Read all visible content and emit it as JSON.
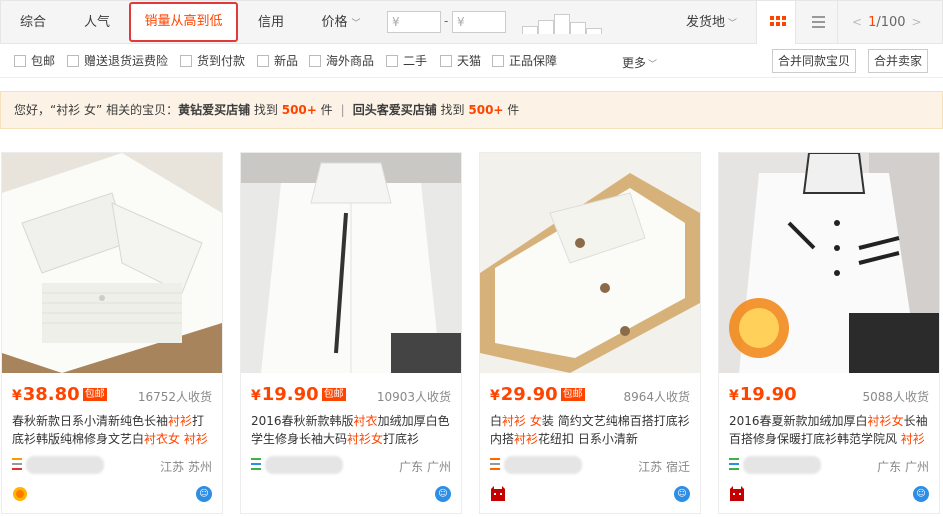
{
  "sort": {
    "tabs": [
      "综合",
      "人气",
      "销量从高到低",
      "信用",
      "价格"
    ],
    "price_placeholder_min": "¥",
    "price_placeholder_max": "¥",
    "price_dash": "-",
    "ship_from": "发货地",
    "pager": {
      "current": "1",
      "total": "/100",
      "prev": "<",
      "next": ">"
    }
  },
  "filters": {
    "options": [
      "包邮",
      "赠送退货运费险",
      "货到付款",
      "新品",
      "海外商品",
      "二手",
      "天猫",
      "正品保障"
    ],
    "more": "更多",
    "merge_same": "合并同款宝贝",
    "merge_seller": "合并卖家"
  },
  "notice": {
    "greet": "您好，“衬衫 女” 相关的宝贝：",
    "shop1": "黄钻爱买店铺",
    "found1": " 找到 ",
    "count1": "500+",
    "unit1": " 件",
    "sep": "|",
    "shop2": "回头客爱买店铺",
    "found2": " 找到 ",
    "count2": "500+",
    "unit2": " 件"
  },
  "products": [
    {
      "price_symbol": "¥",
      "price": "38.80",
      "badge": "包邮",
      "sales": "16752人收货",
      "title_parts": [
        "春秋新款日系小清新纯色长袖",
        "衬衫",
        "打底衫韩版纯棉修身文艺白",
        "衬衣",
        "女 ",
        "衬衫"
      ],
      "location": "江苏 苏州",
      "colors": {
        "icon1": "#ff9900",
        "icon2": "#e03030"
      }
    },
    {
      "price_symbol": "¥",
      "price": "19.90",
      "badge": "包邮",
      "sales": "10903人收货",
      "title_parts": [
        "2016春秋新款韩版",
        "衬衣",
        "加绒加厚白色学生修身长袖大码",
        "衬衫",
        "",
        "女",
        "打底衫"
      ],
      "location": "广东 广州",
      "colors": {
        "icon1": "#3bb34a",
        "icon2": "#2e8ee6"
      }
    },
    {
      "price_symbol": "¥",
      "price": "29.90",
      "badge": "包邮",
      "sales": "8964人收货",
      "title_parts": [
        "白",
        "衬衫",
        " ",
        "女",
        "装 简约文艺纯棉百搭打底衫内搭",
        "衬衫",
        "花纽扣 日系小清新"
      ],
      "location": "江苏 宿迁",
      "colors": {
        "icon1": "#ff6600",
        "icon2": "#c40000"
      }
    },
    {
      "price_symbol": "¥",
      "price": "19.90",
      "badge": "",
      "sales": "5088人收货",
      "title_parts": [
        "2016春夏新款加绒加厚白",
        "衬衫",
        "",
        "女",
        "长袖百搭修身保暖打底衫韩范学院风 ",
        "衬衫"
      ],
      "location": "广东 广州",
      "colors": {
        "icon1": "#3bb34a",
        "icon2": "#c40000"
      }
    }
  ],
  "accent_color": "#ff4400"
}
